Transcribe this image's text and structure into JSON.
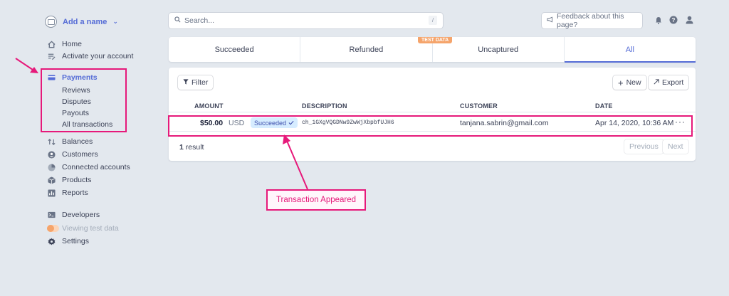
{
  "account": {
    "name": "Add a name"
  },
  "search": {
    "placeholder": "Search...",
    "shortcut": "/"
  },
  "topbar": {
    "feedback": "Feedback about this page?"
  },
  "nav": {
    "home": "Home",
    "activate": "Activate your account",
    "payments": "Payments",
    "payments_sub": [
      "Reviews",
      "Disputes",
      "Payouts",
      "All transactions"
    ],
    "balances": "Balances",
    "customers": "Customers",
    "connected": "Connected accounts",
    "products": "Products",
    "reports": "Reports",
    "developers": "Developers",
    "test_data": "Viewing test data",
    "settings": "Settings"
  },
  "tabs": [
    "Succeeded",
    "Refunded",
    "Uncaptured",
    "All"
  ],
  "active_tab": "All",
  "test_badge": "TEST DATA",
  "toolbar": {
    "filter": "Filter",
    "new": "New",
    "export": "Export"
  },
  "table": {
    "columns": [
      "AMOUNT",
      "DESCRIPTION",
      "CUSTOMER",
      "DATE"
    ],
    "rows": [
      {
        "amount": "$50.00",
        "currency": "USD",
        "status": "Succeeded",
        "description": "ch_1GXgVQGDNw9ZwWjXbpbfUJH6",
        "customer": "tanjana.sabrin@gmail.com",
        "date": "Apr 14, 2020, 10:36 AM"
      }
    ]
  },
  "pagination": {
    "count": "1",
    "result_label": "result",
    "previous": "Previous",
    "next": "Next"
  },
  "annotation": {
    "text": "Transaction Appeared",
    "color": "#e6197a"
  },
  "colors": {
    "accent": "#556cd6",
    "highlight": "#e6197a",
    "test_orange": "#f5a46b",
    "background": "#e3e8ee"
  }
}
